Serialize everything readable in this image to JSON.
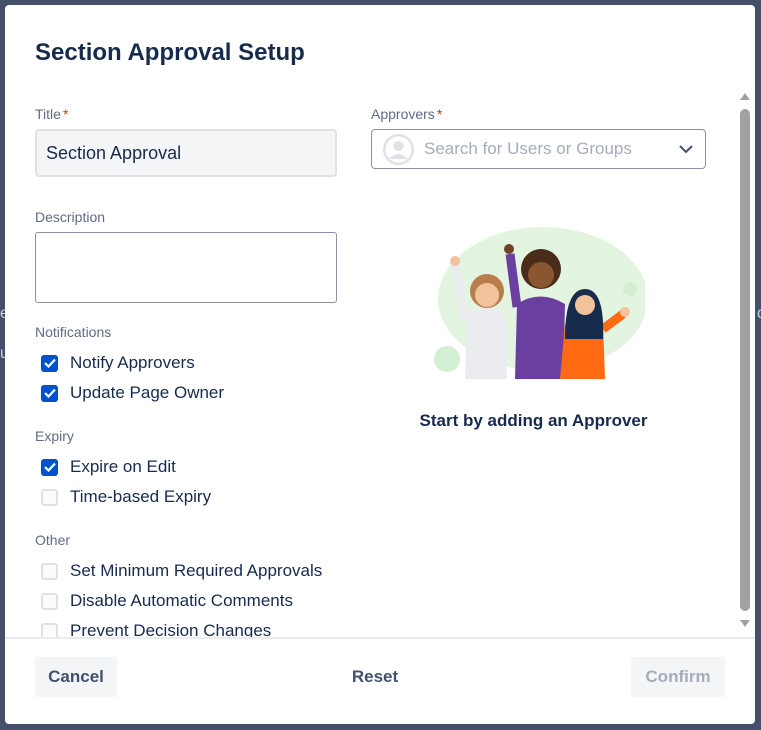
{
  "modal": {
    "title": "Section Approval Setup"
  },
  "form": {
    "title_label": "Title",
    "title_required": "*",
    "title_value": "Section Approval",
    "description_label": "Description",
    "description_value": "",
    "approvers_label": "Approvers",
    "approvers_required": "*",
    "approvers_placeholder": "Search for Users or Groups"
  },
  "notifications": {
    "label": "Notifications",
    "options": [
      {
        "label": "Notify Approvers",
        "checked": true
      },
      {
        "label": "Update Page Owner",
        "checked": true
      }
    ]
  },
  "expiry": {
    "label": "Expiry",
    "options": [
      {
        "label": "Expire on Edit",
        "checked": true
      },
      {
        "label": "Time-based Expiry",
        "checked": false
      }
    ]
  },
  "other": {
    "label": "Other",
    "options": [
      {
        "label": "Set Minimum Required Approvals",
        "checked": false
      },
      {
        "label": "Disable Automatic Comments",
        "checked": false
      },
      {
        "label": "Prevent Decision Changes",
        "checked": false
      }
    ]
  },
  "empty_state": {
    "message": "Start by adding an Approver"
  },
  "footer": {
    "cancel_label": "Cancel",
    "reset_label": "Reset",
    "confirm_label": "Confirm"
  },
  "colors": {
    "accent": "#0052cc",
    "required": "#de350b",
    "overlay": "#44506a"
  }
}
